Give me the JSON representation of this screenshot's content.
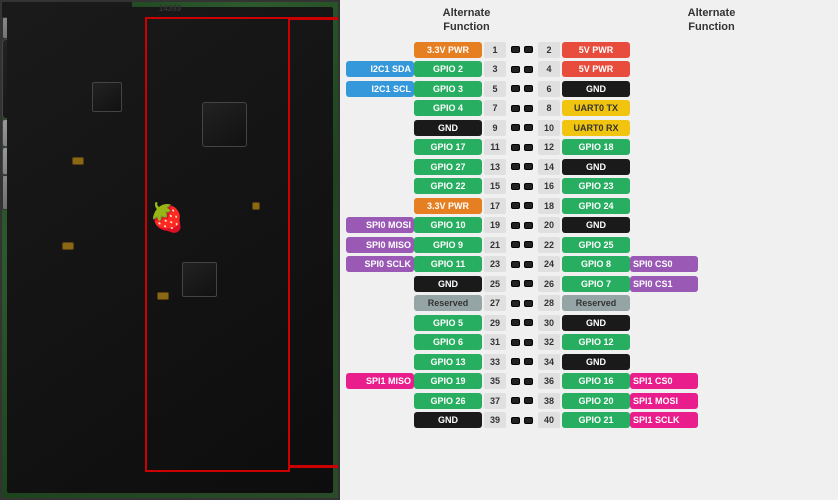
{
  "header": {
    "left_title": "Alternate\nFunction",
    "right_title": "Alternate\nFunction"
  },
  "pins": [
    {
      "left_alt": "",
      "left_name": "3.3V PWR",
      "left_num": "1",
      "right_num": "2",
      "right_name": "5V PWR",
      "right_alt": "",
      "left_color": "c-orange",
      "right_color": "c-red"
    },
    {
      "left_alt": "I2C1 SDA",
      "left_name": "GPIO 2",
      "left_num": "3",
      "right_num": "4",
      "right_name": "5V PWR",
      "right_alt": "",
      "left_color": "c-green",
      "right_color": "c-red",
      "left_alt_color": "c-blue"
    },
    {
      "left_alt": "I2C1 SCL",
      "left_name": "GPIO 3",
      "left_num": "5",
      "right_num": "6",
      "right_name": "GND",
      "right_alt": "",
      "left_color": "c-green",
      "right_color": "c-black",
      "left_alt_color": "c-blue"
    },
    {
      "left_alt": "",
      "left_name": "GPIO 4",
      "left_num": "7",
      "right_num": "8",
      "right_name": "UART0 TX",
      "right_alt": "",
      "left_color": "c-green",
      "right_color": "c-yellow"
    },
    {
      "left_alt": "",
      "left_name": "GND",
      "left_num": "9",
      "right_num": "10",
      "right_name": "UART0 RX",
      "right_alt": "",
      "left_color": "c-black",
      "right_color": "c-yellow"
    },
    {
      "left_alt": "",
      "left_name": "GPIO 17",
      "left_num": "11",
      "right_num": "12",
      "right_name": "GPIO 18",
      "right_alt": "",
      "left_color": "c-green",
      "right_color": "c-green"
    },
    {
      "left_alt": "",
      "left_name": "GPIO 27",
      "left_num": "13",
      "right_num": "14",
      "right_name": "GND",
      "right_alt": "",
      "left_color": "c-green",
      "right_color": "c-black"
    },
    {
      "left_alt": "",
      "left_name": "GPIO 22",
      "left_num": "15",
      "right_num": "16",
      "right_name": "GPIO 23",
      "right_alt": "",
      "left_color": "c-green",
      "right_color": "c-green"
    },
    {
      "left_alt": "",
      "left_name": "3.3V PWR",
      "left_num": "17",
      "right_num": "18",
      "right_name": "GPIO 24",
      "right_alt": "",
      "left_color": "c-orange",
      "right_color": "c-green"
    },
    {
      "left_alt": "SPI0 MOSI",
      "left_name": "GPIO 10",
      "left_num": "19",
      "right_num": "20",
      "right_name": "GND",
      "right_alt": "",
      "left_color": "c-green",
      "right_color": "c-black",
      "left_alt_color": "c-purple"
    },
    {
      "left_alt": "SPI0 MISO",
      "left_name": "GPIO 9",
      "left_num": "21",
      "right_num": "22",
      "right_name": "GPIO 25",
      "right_alt": "",
      "left_color": "c-green",
      "right_color": "c-green",
      "left_alt_color": "c-purple"
    },
    {
      "left_alt": "SPI0 SCLK",
      "left_name": "GPIO 11",
      "left_num": "23",
      "right_num": "24",
      "right_name": "GPIO 8",
      "right_alt": "SPI0 CS0",
      "left_color": "c-green",
      "right_color": "c-green",
      "left_alt_color": "c-purple",
      "right_alt_color": "c-purple"
    },
    {
      "left_alt": "",
      "left_name": "GND",
      "left_num": "25",
      "right_num": "26",
      "right_name": "GPIO 7",
      "right_alt": "SPI0 CS1",
      "left_color": "c-black",
      "right_color": "c-green",
      "right_alt_color": "c-purple"
    },
    {
      "left_alt": "",
      "left_name": "Reserved",
      "left_num": "27",
      "right_num": "28",
      "right_name": "Reserved",
      "right_alt": "",
      "left_color": "c-gray",
      "right_color": "c-gray"
    },
    {
      "left_alt": "",
      "left_name": "GPIO 5",
      "left_num": "29",
      "right_num": "30",
      "right_name": "GND",
      "right_alt": "",
      "left_color": "c-green",
      "right_color": "c-black"
    },
    {
      "left_alt": "",
      "left_name": "GPIO 6",
      "left_num": "31",
      "right_num": "32",
      "right_name": "GPIO 12",
      "right_alt": "",
      "left_color": "c-green",
      "right_color": "c-green"
    },
    {
      "left_alt": "",
      "left_name": "GPIO 13",
      "left_num": "33",
      "right_num": "34",
      "right_name": "GND",
      "right_alt": "",
      "left_color": "c-green",
      "right_color": "c-black"
    },
    {
      "left_alt": "SPI1 MISO",
      "left_name": "GPIO 19",
      "left_num": "35",
      "right_num": "36",
      "right_name": "GPIO 16",
      "right_alt": "SPI1 CS0",
      "left_color": "c-green",
      "right_color": "c-green",
      "left_alt_color": "c-pink",
      "right_alt_color": "c-pink"
    },
    {
      "left_alt": "",
      "left_name": "GPIO 26",
      "left_num": "37",
      "right_num": "38",
      "right_name": "GPIO 20",
      "right_alt": "SPI1 MOSI",
      "left_color": "c-green",
      "right_color": "c-green",
      "right_alt_color": "c-pink"
    },
    {
      "left_alt": "",
      "left_name": "GND",
      "left_num": "39",
      "right_num": "40",
      "right_name": "GPIO 21",
      "right_alt": "SPI1 SCLK",
      "left_color": "c-black",
      "right_color": "c-green",
      "right_alt_color": "c-pink"
    }
  ]
}
